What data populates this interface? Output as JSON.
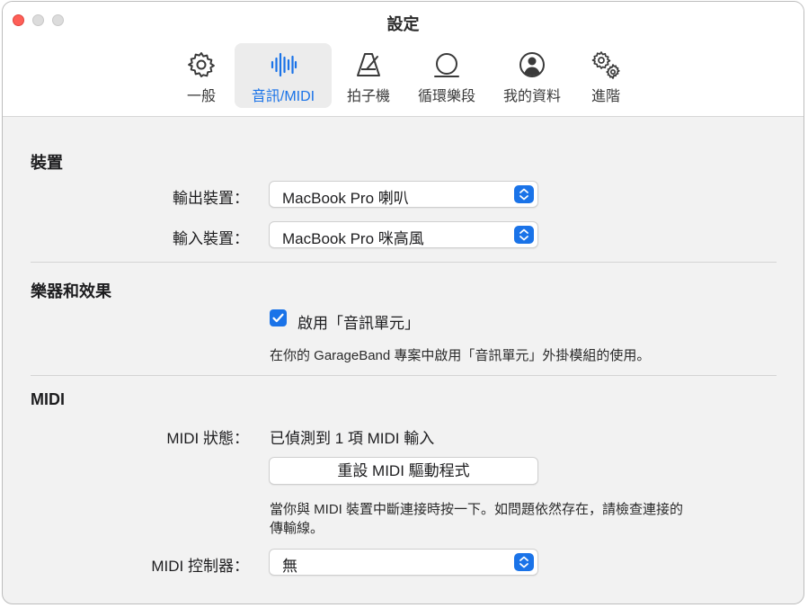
{
  "window": {
    "title": "設定"
  },
  "tabs": [
    {
      "label": "一般",
      "icon": "gear-icon",
      "selected": false
    },
    {
      "label": "音訊/MIDI",
      "icon": "waveform-icon",
      "selected": true
    },
    {
      "label": "拍子機",
      "icon": "metronome-icon",
      "selected": false
    },
    {
      "label": "循環樂段",
      "icon": "loop-icon",
      "selected": false
    },
    {
      "label": "我的資料",
      "icon": "person-icon",
      "selected": false
    },
    {
      "label": "進階",
      "icon": "gears-icon",
      "selected": false
    }
  ],
  "devices": {
    "title": "裝置",
    "output_label": "輸出裝置：",
    "output_value": "MacBook Pro 喇叭",
    "input_label": "輸入裝置：",
    "input_value": "MacBook Pro 咪高風"
  },
  "instruments": {
    "title": "樂器和效果",
    "checkbox_label": "啟用「音訊單元」",
    "checked": true,
    "description": "在你的 GarageBand 專案中啟用「音訊單元」外掛模組的使用。"
  },
  "midi": {
    "title": "MIDI",
    "status_label": "MIDI 狀態：",
    "status_value": "已偵測到 1 項 MIDI 輸入",
    "reset_button": "重設 MIDI 驅動程式",
    "help_line1": "當你與 MIDI 裝置中斷連接時按一下。如問題依然存在，請檢查連接的",
    "help_line2": "傳輸線。",
    "controller_label": "MIDI 控制器：",
    "controller_value": "無"
  },
  "colors": {
    "accent": "#1a73e8",
    "close": "#fe5f57"
  }
}
